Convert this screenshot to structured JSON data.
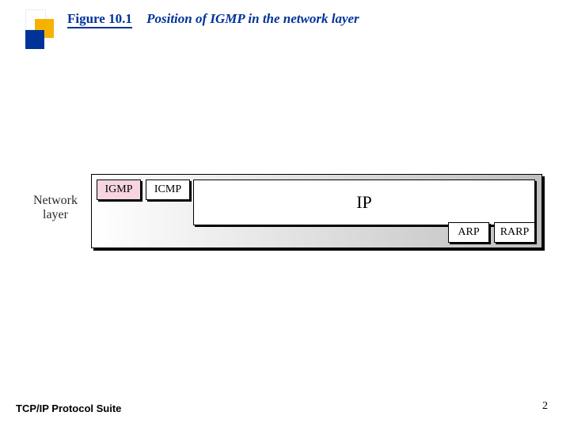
{
  "header": {
    "figure_number": "Figure 10.1",
    "title": "Position of IGMP in the network layer"
  },
  "layer_label": {
    "line1": "Network",
    "line2": "layer"
  },
  "boxes": {
    "igmp": "IGMP",
    "icmp": "ICMP",
    "ip": "IP",
    "arp": "ARP",
    "rarp": "RARP"
  },
  "footer": {
    "left": "TCP/IP Protocol Suite",
    "page": "2"
  },
  "colors": {
    "accent_blue": "#003399",
    "accent_gold": "#f5b300",
    "igmp_fill": "#f6d5df"
  }
}
